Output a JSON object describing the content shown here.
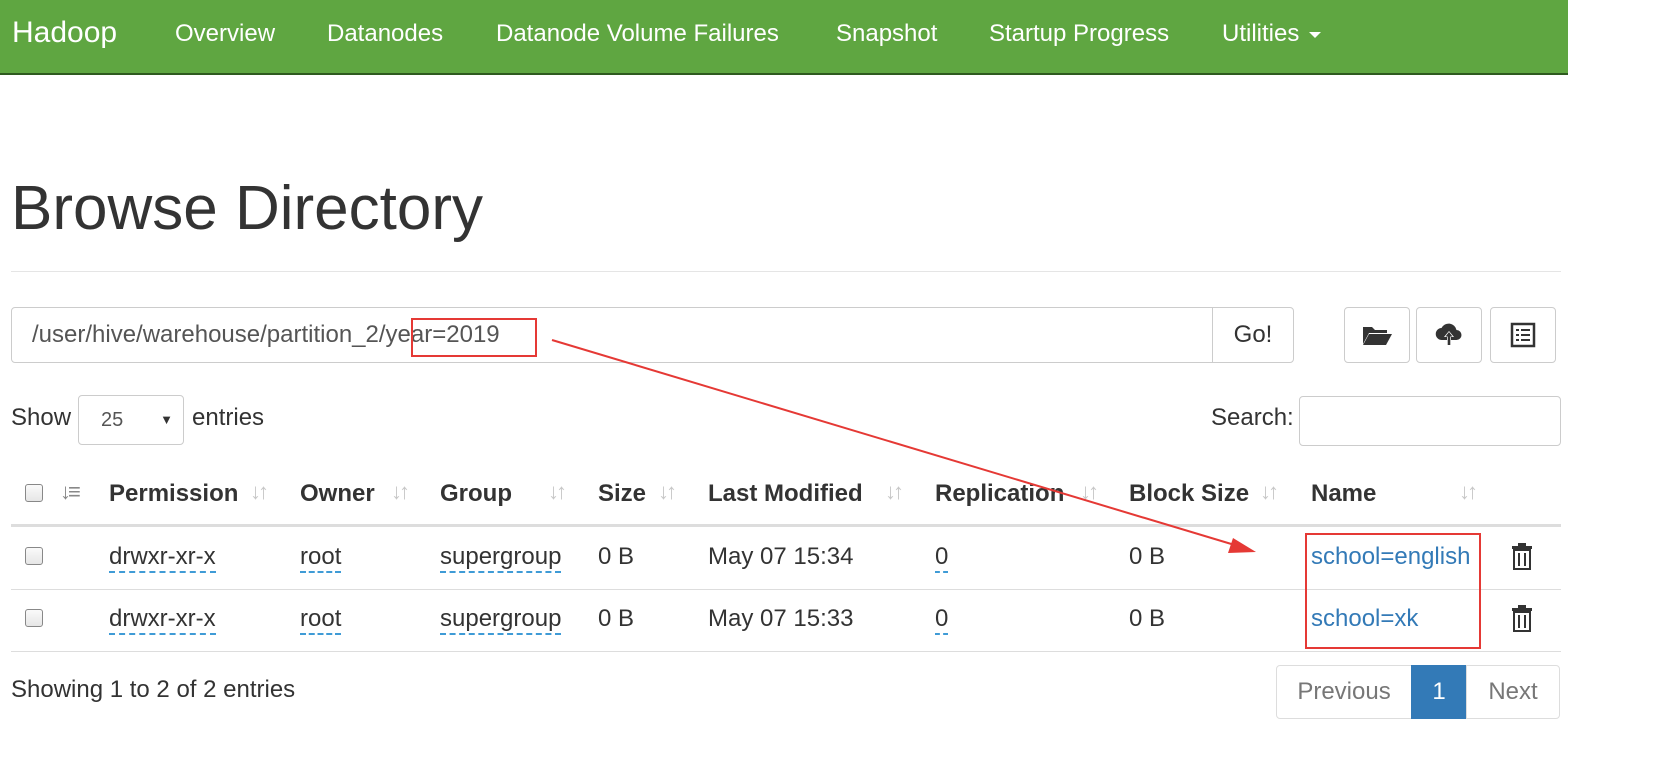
{
  "navbar": {
    "brand": "Hadoop",
    "items": [
      {
        "label": "Overview"
      },
      {
        "label": "Datanodes"
      },
      {
        "label": "Datanode Volume Failures"
      },
      {
        "label": "Snapshot"
      },
      {
        "label": "Startup Progress"
      },
      {
        "label": "Utilities"
      }
    ]
  },
  "page": {
    "title": "Browse Directory"
  },
  "path": {
    "value": "/user/hive/warehouse/partition_2/year=2019",
    "go_label": "Go!"
  },
  "toolbar": {
    "icons": [
      "folder-open-icon",
      "cloud-upload-icon",
      "list-icon"
    ]
  },
  "entries": {
    "show_label": "Show",
    "selected": "25",
    "suffix_label": "entries"
  },
  "search": {
    "label": "Search:",
    "value": ""
  },
  "table": {
    "columns": [
      "Permission",
      "Owner",
      "Group",
      "Size",
      "Last Modified",
      "Replication",
      "Block Size",
      "Name"
    ],
    "rows": [
      {
        "permission": "drwxr-xr-x",
        "owner": "root",
        "group": "supergroup",
        "size": "0 B",
        "last_modified": "May 07 15:34",
        "replication": "0",
        "block_size": "0 B",
        "name": "school=english"
      },
      {
        "permission": "drwxr-xr-x",
        "owner": "root",
        "group": "supergroup",
        "size": "0 B",
        "last_modified": "May 07 15:33",
        "replication": "0",
        "block_size": "0 B",
        "name": "school=xk"
      }
    ]
  },
  "footer": {
    "info": "Showing 1 to 2 of 2 entries"
  },
  "pagination": {
    "previous": "Previous",
    "current": "1",
    "next": "Next"
  },
  "colors": {
    "navbar": "#5fa641",
    "link": "#337ab7",
    "annotation": "#e53935",
    "active_page": "#337ab7"
  }
}
